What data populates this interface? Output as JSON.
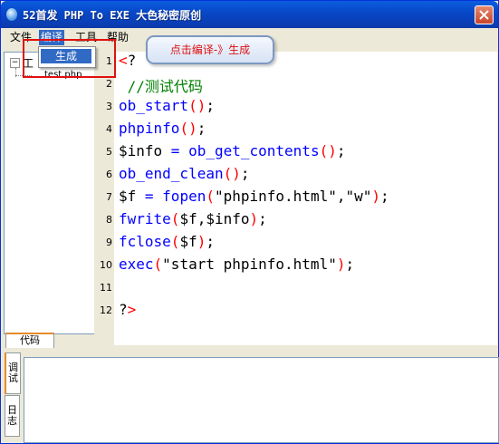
{
  "window": {
    "title": "52首发 PHP To EXE 大色秘密原创"
  },
  "menu": {
    "items": [
      {
        "label": "文件"
      },
      {
        "label": "编译"
      },
      {
        "label": "工具"
      },
      {
        "label": "帮助"
      }
    ],
    "active_dropdown": {
      "item": "生成"
    }
  },
  "annotation": {
    "tooltip": "点击编译-》生成",
    "highlight_color": "#e01010"
  },
  "tree": {
    "root_label": "工",
    "toggle": "−",
    "file": "test.php"
  },
  "editor": {
    "lines": [
      {
        "n": "1",
        "tokens": [
          {
            "t": "<",
            "c": "#ff0000"
          },
          {
            "t": "?",
            "c": "#000000"
          }
        ]
      },
      {
        "n": "2",
        "tokens": [
          {
            "t": " //测试代码",
            "c": "#008000"
          }
        ]
      },
      {
        "n": "3",
        "tokens": [
          {
            "t": "ob_start",
            "c": "#0000ff"
          },
          {
            "t": "()",
            "c": "#ff0000"
          },
          {
            "t": ";",
            "c": "#000000"
          }
        ]
      },
      {
        "n": "4",
        "tokens": [
          {
            "t": "phpinfo",
            "c": "#0000ff"
          },
          {
            "t": "()",
            "c": "#ff0000"
          },
          {
            "t": ";",
            "c": "#000000"
          }
        ]
      },
      {
        "n": "5",
        "tokens": [
          {
            "t": "$info",
            "c": "#000000"
          },
          {
            "t": " = ",
            "c": "#0000ff"
          },
          {
            "t": "ob_get_contents",
            "c": "#0000ff"
          },
          {
            "t": "()",
            "c": "#ff0000"
          },
          {
            "t": ";",
            "c": "#000000"
          }
        ]
      },
      {
        "n": "6",
        "tokens": [
          {
            "t": "ob_end_clean",
            "c": "#0000ff"
          },
          {
            "t": "()",
            "c": "#ff0000"
          },
          {
            "t": ";",
            "c": "#000000"
          }
        ]
      },
      {
        "n": "7",
        "tokens": [
          {
            "t": "$f",
            "c": "#000000"
          },
          {
            "t": " = ",
            "c": "#0000ff"
          },
          {
            "t": "fopen",
            "c": "#0000ff"
          },
          {
            "t": "(",
            "c": "#ff0000"
          },
          {
            "t": "\"phpinfo.html\",\"w\"",
            "c": "#000000"
          },
          {
            "t": ")",
            "c": "#ff0000"
          },
          {
            "t": ";",
            "c": "#000000"
          }
        ]
      },
      {
        "n": "8",
        "tokens": [
          {
            "t": "fwrite",
            "c": "#0000ff"
          },
          {
            "t": "(",
            "c": "#ff0000"
          },
          {
            "t": "$f,$info",
            "c": "#000000"
          },
          {
            "t": ")",
            "c": "#ff0000"
          },
          {
            "t": ";",
            "c": "#000000"
          }
        ]
      },
      {
        "n": "9",
        "tokens": [
          {
            "t": "fclose",
            "c": "#0000ff"
          },
          {
            "t": "(",
            "c": "#ff0000"
          },
          {
            "t": "$f",
            "c": "#000000"
          },
          {
            "t": ")",
            "c": "#ff0000"
          },
          {
            "t": ";",
            "c": "#000000"
          }
        ]
      },
      {
        "n": "10",
        "tokens": [
          {
            "t": "exec",
            "c": "#0000ff"
          },
          {
            "t": "(",
            "c": "#ff0000"
          },
          {
            "t": "\"start phpinfo.html\"",
            "c": "#000000"
          },
          {
            "t": ")",
            "c": "#ff0000"
          },
          {
            "t": ";",
            "c": "#000000"
          }
        ]
      },
      {
        "n": "11",
        "tokens": []
      },
      {
        "n": "12",
        "tokens": [
          {
            "t": "?",
            "c": "#000000"
          },
          {
            "t": ">",
            "c": "#ff0000"
          }
        ]
      }
    ]
  },
  "tabs": {
    "code": "代码",
    "debug": "调试",
    "log": "日志"
  }
}
